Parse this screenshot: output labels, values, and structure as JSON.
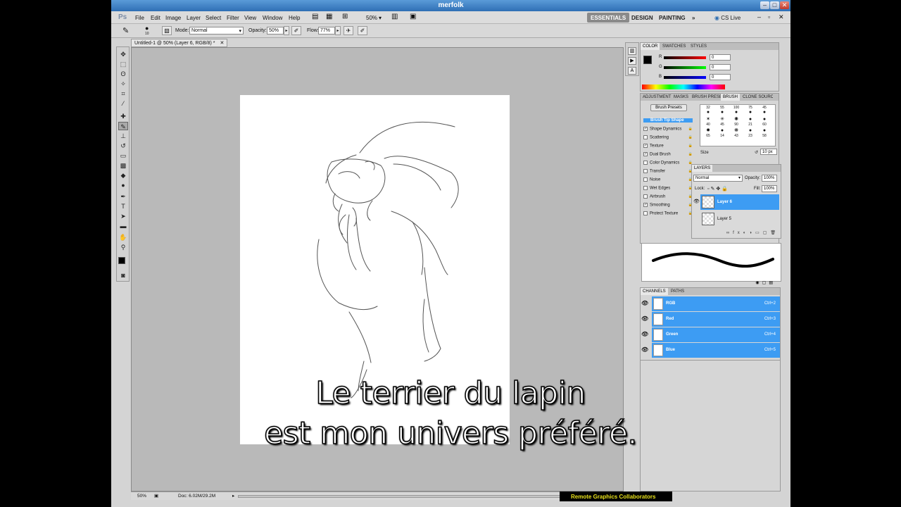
{
  "window": {
    "title": "merfolk"
  },
  "menu": {
    "app_logo": "Ps",
    "items": [
      "File",
      "Edit",
      "Image",
      "Layer",
      "Select",
      "Filter",
      "View",
      "Window",
      "Help"
    ],
    "zoom": "50%"
  },
  "workspaces": {
    "essentials": "ESSENTIALS",
    "design": "DESIGN",
    "painting": "PAINTING",
    "more": "»",
    "cslive": "CS Live"
  },
  "options": {
    "brush_size": "10",
    "mode_label": "Mode:",
    "mode_value": "Normal",
    "opacity_label": "Opacity:",
    "opacity_value": "50%",
    "flow_label": "Flow:",
    "flow_value": "77%"
  },
  "document": {
    "tab_title": "Untitled-1 @ 50% (Layer 6, RGB/8) *"
  },
  "status": {
    "zoom": "50%",
    "doc": "Doc: 6.02M/29.2M"
  },
  "color_panel": {
    "tabs": [
      "COLOR",
      "SWATCHES",
      "STYLES"
    ],
    "channels": [
      {
        "label": "R",
        "value": "0"
      },
      {
        "label": "G",
        "value": "0"
      },
      {
        "label": "B",
        "value": "0"
      }
    ]
  },
  "brush_panel": {
    "tabs": [
      "ADJUSTMENT",
      "MASKS",
      "BRUSH PRESETS",
      "BRUSH",
      "CLONE SOURCE"
    ],
    "presets_button": "Brush Presets",
    "options": [
      {
        "label": "Brush Tip Shape",
        "checked": null,
        "active": true
      },
      {
        "label": "Shape Dynamics",
        "checked": true
      },
      {
        "label": "Scattering",
        "checked": false
      },
      {
        "label": "Texture",
        "checked": true
      },
      {
        "label": "Dual Brush",
        "checked": true
      },
      {
        "label": "Color Dynamics",
        "checked": false
      },
      {
        "label": "Transfer",
        "checked": false
      },
      {
        "label": "Noise",
        "checked": false
      },
      {
        "label": "Wet Edges",
        "checked": false
      },
      {
        "label": "Airbrush",
        "checked": false
      },
      {
        "label": "Smoothing",
        "checked": true
      },
      {
        "label": "Protect Texture",
        "checked": false
      }
    ],
    "tip_sizes": [
      "32",
      "55",
      "100",
      "75",
      "45",
      "40",
      "45",
      "90",
      "21",
      "60",
      "65",
      "14",
      "43",
      "23",
      "58"
    ],
    "size_label": "Size",
    "size_value": "10 px"
  },
  "layers_panel": {
    "tab": "LAYERS",
    "blend": "Normal",
    "opacity_label": "Opacity:",
    "opacity": "100%",
    "lock_label": "Lock:",
    "fill_label": "Fill:",
    "fill": "100%",
    "layers": [
      "Layer 6",
      "Layer 5"
    ]
  },
  "channels_panel": {
    "tabs": [
      "CHANNELS",
      "PATHS"
    ],
    "channels": [
      {
        "name": "RGB",
        "shortcut": "Ctrl+2"
      },
      {
        "name": "Red",
        "shortcut": "Ctrl+3"
      },
      {
        "name": "Green",
        "shortcut": "Ctrl+4"
      },
      {
        "name": "Blue",
        "shortcut": "Ctrl+5"
      }
    ]
  },
  "subtitle": {
    "line1": "Le terrier du lapin",
    "line2": "est mon univers préféré."
  },
  "watermark": "Remote Graphics Collaborators"
}
